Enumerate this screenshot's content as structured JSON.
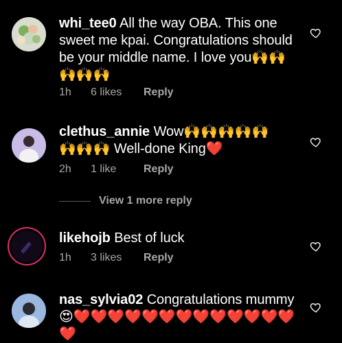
{
  "comments": [
    {
      "username": "whi_tee0",
      "text": "All the way OBA. This one sweet me kpai. Congratulations should be your middle name. I love you🙌🙌🙌🙌🙌",
      "time": "1h",
      "likes": "6 likes",
      "reply": "Reply"
    },
    {
      "username": "clethus_annie",
      "text": "Wow🙌🙌🙌🙌🙌🙌🙌🙌 Well-done King❤️",
      "time": "2h",
      "likes": "1 like",
      "reply": "Reply"
    },
    {
      "username": "likehojb",
      "text": "Best of luck",
      "time": "1h",
      "likes": "3 likes",
      "reply": "Reply"
    },
    {
      "username": "nas_sylvia02",
      "text": "Congratulations mummy 😍❤️❤️❤️❤️❤️❤️❤️❤️❤️❤️❤️❤️❤️❤️",
      "time": "",
      "likes": "",
      "reply": ""
    }
  ],
  "view_more": "View 1 more reply",
  "icons": {
    "like": "heart-outline-icon"
  }
}
